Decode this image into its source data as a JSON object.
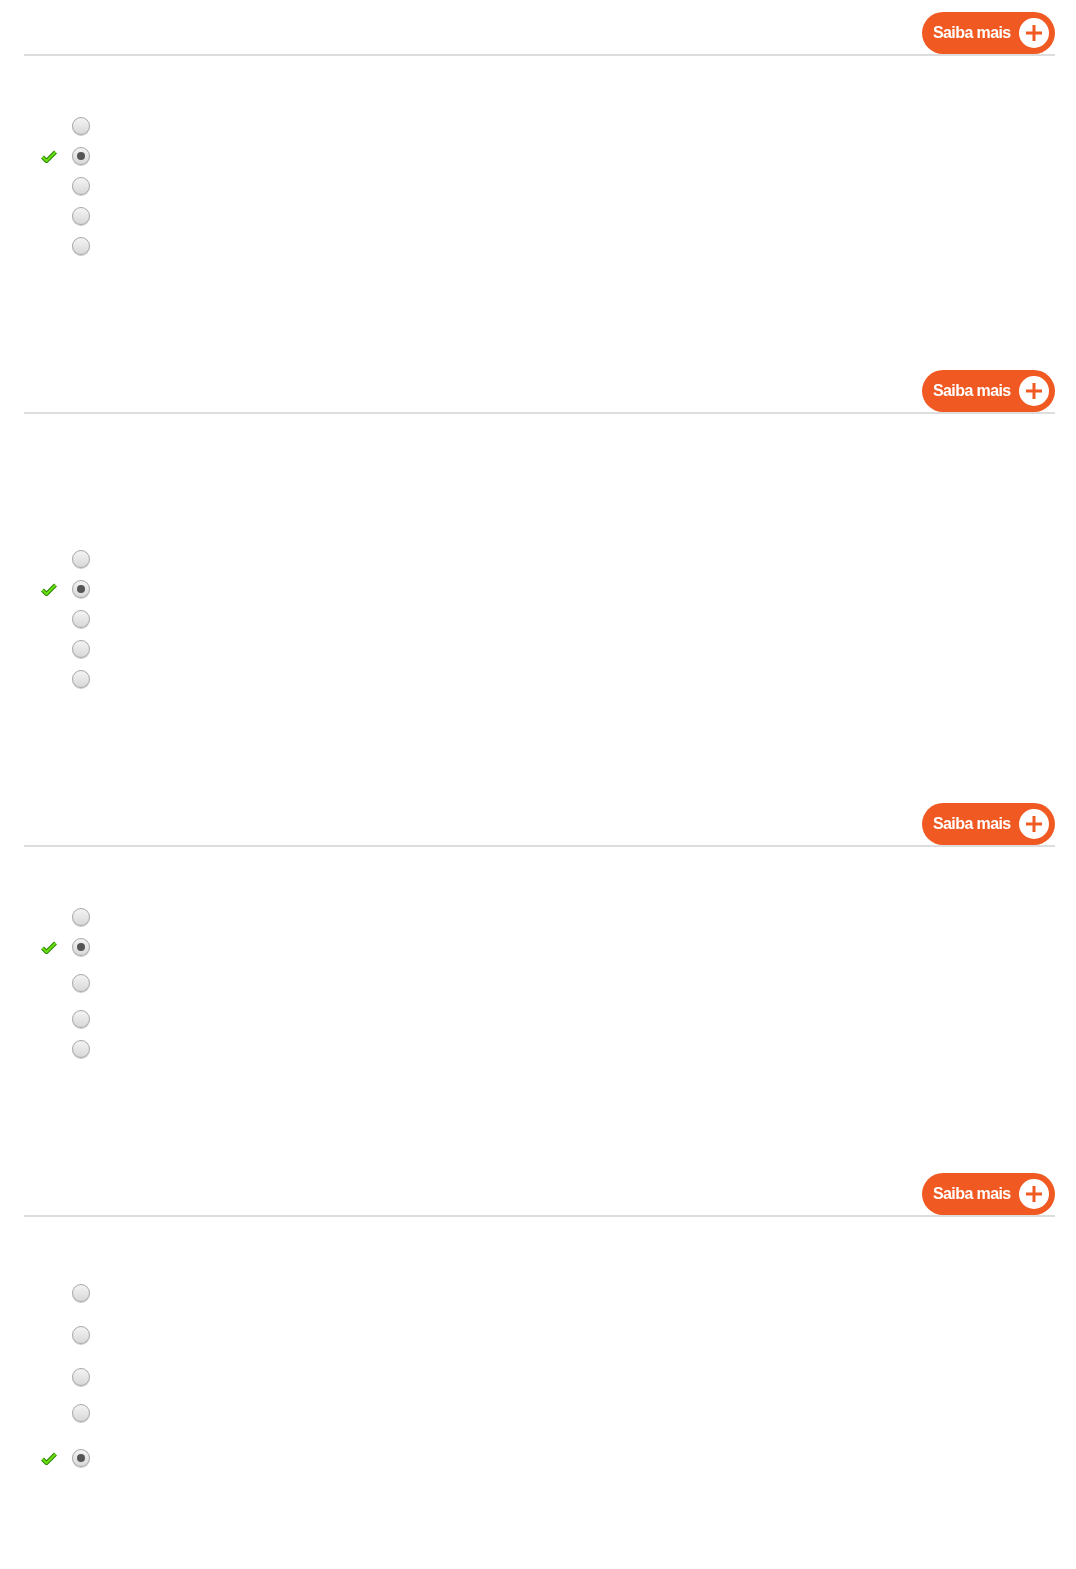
{
  "questions": [
    {
      "button": "Saiba mais",
      "options": [
        {
          "selected": false,
          "correct": false
        },
        {
          "selected": true,
          "correct": true
        },
        {
          "selected": false,
          "correct": false
        },
        {
          "selected": false,
          "correct": false
        },
        {
          "selected": false,
          "correct": false
        }
      ]
    },
    {
      "button": "Saiba mais",
      "options": [
        {
          "selected": false,
          "correct": false
        },
        {
          "selected": true,
          "correct": true
        },
        {
          "selected": false,
          "correct": false
        },
        {
          "selected": false,
          "correct": false
        },
        {
          "selected": false,
          "correct": false
        }
      ]
    },
    {
      "button": "Saiba mais",
      "options": [
        {
          "selected": false,
          "correct": false
        },
        {
          "selected": true,
          "correct": true
        },
        {
          "selected": false,
          "correct": false
        },
        {
          "selected": false,
          "correct": false
        },
        {
          "selected": false,
          "correct": false
        }
      ]
    },
    {
      "button": "Saiba mais",
      "options": [
        {
          "selected": false,
          "correct": false
        },
        {
          "selected": false,
          "correct": false
        },
        {
          "selected": false,
          "correct": false
        },
        {
          "selected": false,
          "correct": false
        },
        {
          "selected": true,
          "correct": true
        }
      ]
    }
  ]
}
